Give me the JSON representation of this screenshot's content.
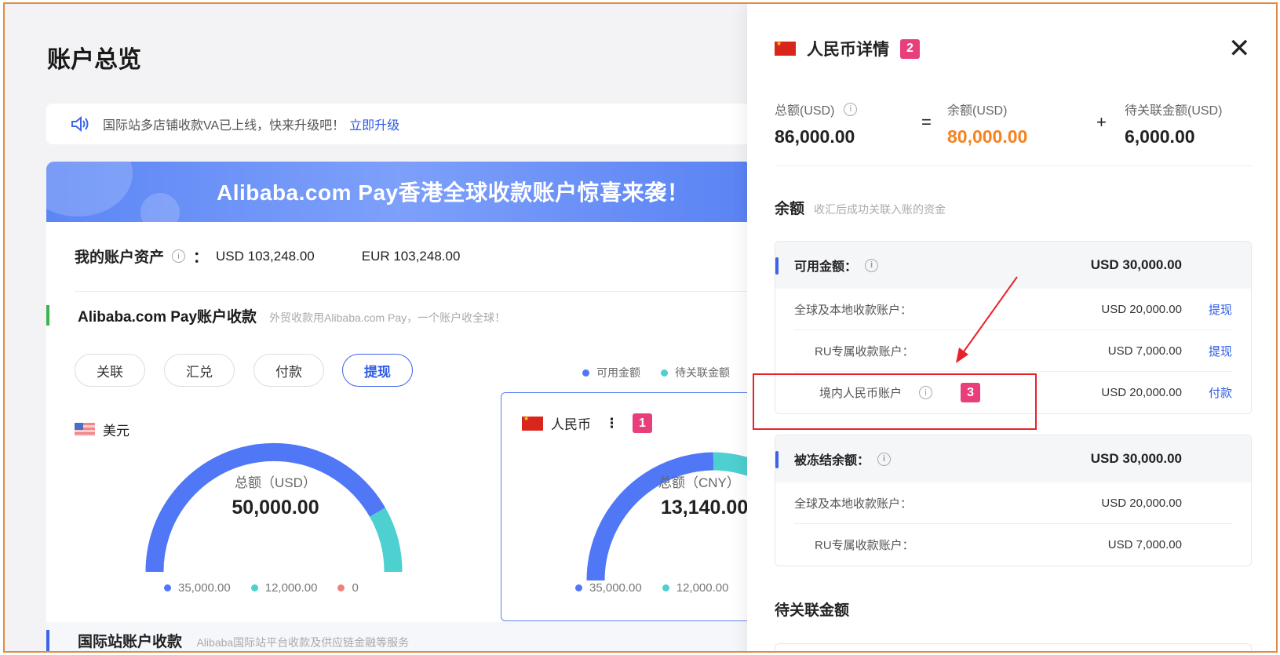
{
  "page_title": "账户总览",
  "notice": {
    "text": "国际站多店铺收款VA已上线，快来升级吧！",
    "link": "立即升级"
  },
  "banner": "Alibaba.com Pay香港全球收款账户惊喜来袭！",
  "assets": {
    "label": "我的账户资产",
    "colon": "：",
    "usd": "USD 103,248.00",
    "eur": "EUR 103,248.00"
  },
  "section": {
    "title": "Alibaba.com Pay账户收款",
    "desc": "外贸收款用Alibaba.com Pay，一个账户收全球！"
  },
  "buttons": [
    "关联",
    "汇兑",
    "付款",
    "提现"
  ],
  "legend": [
    "可用金额",
    "待关联金额"
  ],
  "usd_card": {
    "currency": "美元",
    "total_label": "总额（USD）",
    "total": "50,000.00",
    "values": [
      "35,000.00",
      "12,000.00",
      "0"
    ]
  },
  "rmb_card": {
    "currency": "人民币",
    "more": "⋮",
    "badge": "1",
    "total_label": "总额（CNY）",
    "total": "13,140.00",
    "values": [
      "35,000.00",
      "12,000.00"
    ]
  },
  "bottom_section": {
    "title": "国际站账户收款",
    "desc": "Alibaba国际站平台收款及供应链金融等服务"
  },
  "drawer": {
    "title": "人民币详情",
    "badge": "2",
    "close": "✕",
    "summary": {
      "total_label": "总额(USD)",
      "total": "86,000.00",
      "eq": "=",
      "balance_label": "余额(USD)",
      "balance": "80,000.00",
      "plus": "+",
      "pending_label": "待关联金额(USD)",
      "pending": "6,000.00"
    },
    "balance_section": {
      "title": "余额",
      "desc": "收汇后成功关联入账的资金"
    },
    "available": {
      "label": "可用金额：",
      "amount": "USD 30,000.00",
      "rows": [
        {
          "label": "全球及本地收款账户：",
          "amount": "USD 20,000.00",
          "action": "提现"
        },
        {
          "label": "RU专属收款账户：",
          "amount": "USD 7,000.00",
          "action": "提现"
        },
        {
          "label": "境内人民币账户",
          "amount": "USD 20,000.00",
          "action": "付款",
          "badge": "3"
        }
      ]
    },
    "frozen": {
      "label": "被冻结余额：",
      "amount": "USD 30,000.00",
      "rows": [
        {
          "label": "全球及本地收款账户：",
          "amount": "USD 20,000.00"
        },
        {
          "label": "RU专属收款账户：",
          "amount": "USD 7,000.00"
        }
      ]
    },
    "pending_section": {
      "title": "待关联金额"
    }
  },
  "colors": {
    "blue": "#4f77f6",
    "teal": "#4ecfd0",
    "pink": "#f08080",
    "orange": "#f5821f",
    "annotation": "#e8222b"
  }
}
